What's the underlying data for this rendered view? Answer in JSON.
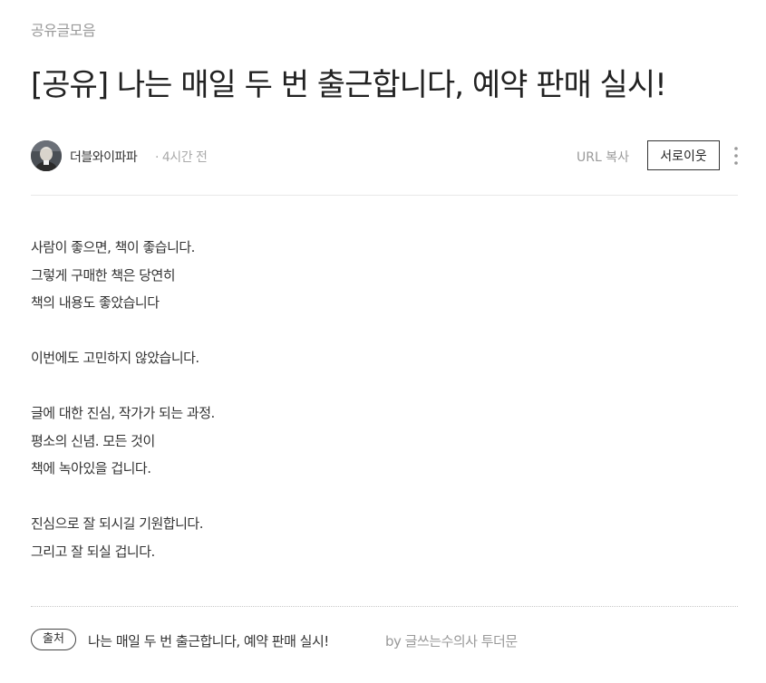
{
  "post": {
    "category": "공유글모음",
    "title": "[공유] 나는 매일 두 번 출근합니다, 예약 판매 실시!",
    "author": "더블와이파파",
    "time": "· 4시간 전",
    "url_copy": "URL 복사",
    "neighbor_button": "서로이웃"
  },
  "body": {
    "lines": [
      "사람이 좋으면, 책이 좋습니다.",
      "그렇게 구매한 책은 당연히",
      "책의 내용도 좋았습니다",
      "",
      "이번에도 고민하지 않았습니다.",
      "",
      "글에 대한 진심, 작가가 되는 과정.",
      "평소의 신념. 모든 것이",
      "책에 녹아있을 겁니다.",
      "",
      "진심으로 잘 되시길 기원합니다.",
      "그리고 잘 되실 겁니다."
    ]
  },
  "source": {
    "badge": "출처",
    "link_text": "나는 매일 두 번 출근합니다, 예약 판매 실시!",
    "by_text": "by 글쓰는수의사 투더문"
  },
  "icons": {
    "more": "more-vertical-icon",
    "avatar": "avatar-image"
  }
}
